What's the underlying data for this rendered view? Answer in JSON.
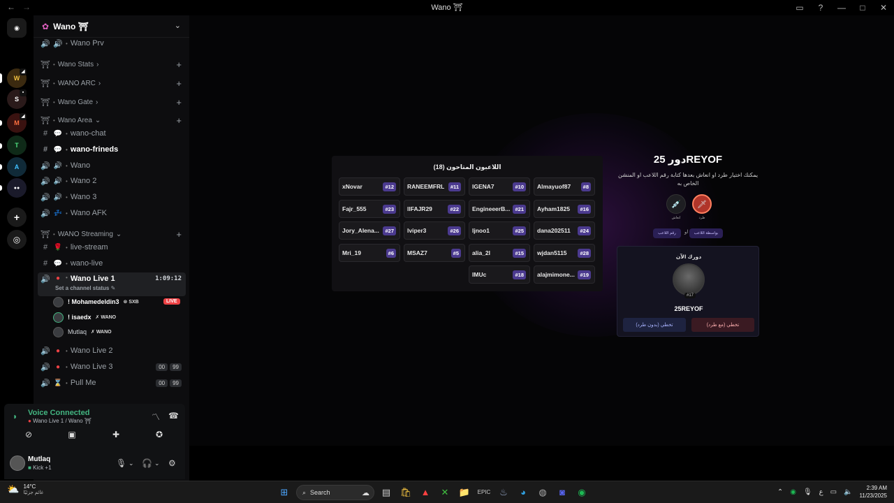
{
  "window": {
    "title": "Wano ⛩",
    "back": "←",
    "forward": "→"
  },
  "server": {
    "name": "Wano ⛩"
  },
  "channels": [
    {
      "kind": "voice",
      "name": "Wano Prv"
    },
    {
      "kind": "category",
      "name": "Wano Stats"
    },
    {
      "kind": "category",
      "name": "WANO ARC"
    },
    {
      "kind": "category",
      "name": "Wano Gate"
    },
    {
      "kind": "category",
      "name": "Wano Area"
    },
    {
      "kind": "text",
      "name": "wano-chat"
    },
    {
      "kind": "text",
      "name": "wano-frineds"
    },
    {
      "kind": "voice",
      "name": "Wano"
    },
    {
      "kind": "voice",
      "name": "Wano 2"
    },
    {
      "kind": "voice",
      "name": "Wano 3"
    },
    {
      "kind": "voice",
      "name": "Wano AFK"
    },
    {
      "kind": "category",
      "name": "WANO Streaming"
    },
    {
      "kind": "text",
      "name": "live-stream"
    },
    {
      "kind": "text",
      "name": "wano-live"
    },
    {
      "kind": "voice",
      "name": "Wano Live 1",
      "timer": "1:09:12",
      "status": "Set a channel status"
    },
    {
      "kind": "voice",
      "name": "Wano Live 2"
    },
    {
      "kind": "voice",
      "name": "Wano Live 3",
      "chips": [
        "00",
        "99"
      ]
    },
    {
      "kind": "voice",
      "name": "Pull Me",
      "chips": [
        "00",
        "99"
      ]
    }
  ],
  "voice_users": [
    {
      "name": "! Mohamedeldin3",
      "tag": "SXB",
      "live": "LIVE"
    },
    {
      "name": "! isaedx",
      "tag": "WANO"
    },
    {
      "name": "Mutlaq",
      "tag": "WANO"
    }
  ],
  "voice_panel": {
    "title": "Voice Connected",
    "sub": "Wano Live 1 / Wano ⛩"
  },
  "user_panel": {
    "name": "Mutlaq",
    "status": "Kick +1"
  },
  "activity": {
    "players_title": "اللاعبون المتاحون (18)",
    "players": [
      {
        "name": "xNovar",
        "num": "#12"
      },
      {
        "name": "RANEEMFRL",
        "num": "#11"
      },
      {
        "name": "IGENA7",
        "num": "#10"
      },
      {
        "name": "Almayuof87",
        "num": "#8"
      },
      {
        "name": "Fajr_555",
        "num": "#23"
      },
      {
        "name": "llFAJR29",
        "num": "#22"
      },
      {
        "name": "EngineeerB...",
        "num": "#21"
      },
      {
        "name": "Ayham1825",
        "num": "#16"
      },
      {
        "name": "Jory_Alena...",
        "num": "#27"
      },
      {
        "name": "lviper3",
        "num": "#26"
      },
      {
        "name": "ljnoo1",
        "num": "#25"
      },
      {
        "name": "dana202511",
        "num": "#24"
      },
      {
        "name": "Mri_19",
        "num": "#6"
      },
      {
        "name": "MSAZ7",
        "num": "#5"
      },
      {
        "name": "alia_2l",
        "num": "#15"
      },
      {
        "name": "wjdan5115",
        "num": "#28"
      },
      {
        "name": "IMUc",
        "num": "#18"
      },
      {
        "name": "alajmimone...",
        "num": "#19"
      }
    ],
    "turn_title": "دور 25REYOF",
    "turn_desc": "يمكنك اختيار طرد او انعاش بعدها كتابة رقم اللاعب او المنشن الخاص به",
    "action_kick": "طرد",
    "action_revive": "انعاش",
    "mode_mention": "بواسطة اللاعب",
    "mode_or": "او",
    "mode_number": "رقم اللاعب",
    "now_label": "دورك الآن",
    "now_pos": "#17",
    "now_name": "25REYOF",
    "skip_no_kick": "تخطي (بدون طرد)",
    "skip_kick": "تخطي (مع طرد)"
  },
  "taskbar": {
    "temp": "14°C",
    "cond": "غائم جزئيًا",
    "search": "Search",
    "lang": "ع",
    "time": "2:39 AM",
    "date": "11/23/2025"
  }
}
